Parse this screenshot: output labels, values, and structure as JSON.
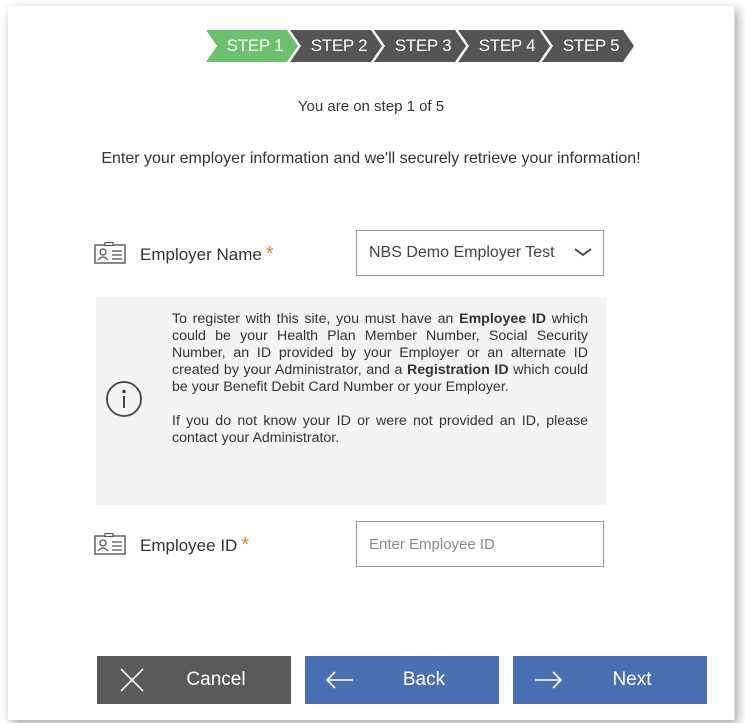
{
  "steps": [
    {
      "label": "STEP 1",
      "state": "current"
    },
    {
      "label": "STEP 2",
      "state": "todo"
    },
    {
      "label": "STEP 3",
      "state": "todo"
    },
    {
      "label": "STEP 4",
      "state": "todo"
    },
    {
      "label": "STEP 5",
      "state": "todo"
    }
  ],
  "step_status": "You are on step 1 of 5",
  "intro": "Enter your employer information and we'll securely retrieve your information!",
  "employer": {
    "label": "Employer Name",
    "required_mark": "*",
    "value": "NBS Demo Employer Test",
    "icon": "id-card-icon"
  },
  "info": {
    "icon": "info-circle-icon",
    "p1_a": "To register with this site, you must have an ",
    "p1_b": "Employee ID",
    "p1_c": " which could be your Health Plan Member Number, Social Security Number, an ID provided by your Employer or an alternate ID created by your Administrator, and a ",
    "p1_d": "Registration ID",
    "p1_e": " which could be your Benefit Debit Card Number or your Employer.",
    "p2": "If you do not know your ID or were not provided an ID, please contact your Administrator."
  },
  "employee": {
    "label": "Employee ID",
    "required_mark": "*",
    "placeholder": "Enter Employee ID",
    "value": "",
    "icon": "id-card-icon"
  },
  "buttons": {
    "cancel": "Cancel",
    "back": "Back",
    "next": "Next"
  },
  "colors": {
    "step_active": "#6cc06e",
    "step_inactive": "#555555",
    "required": "#e08a23",
    "primary_button": "#4a6fb5",
    "cancel_button": "#5a5a5a",
    "info_bg": "#f2f4f6"
  }
}
